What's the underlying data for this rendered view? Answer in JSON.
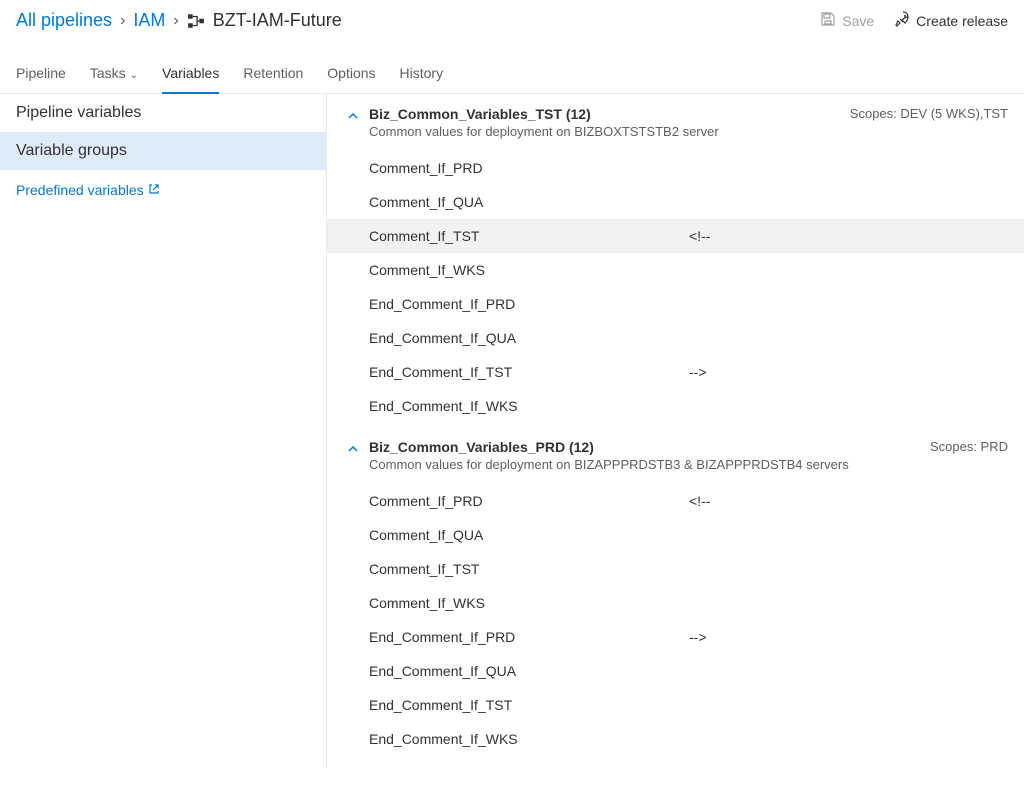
{
  "breadcrumb": {
    "root": "All pipelines",
    "parent": "IAM",
    "title": "BZT-IAM-Future"
  },
  "header_actions": {
    "save": "Save",
    "create_release": "Create release"
  },
  "tabs": {
    "pipeline": "Pipeline",
    "tasks": "Tasks",
    "variables": "Variables",
    "retention": "Retention",
    "options": "Options",
    "history": "History"
  },
  "sidebar": {
    "pipeline_vars": "Pipeline variables",
    "variable_groups": "Variable groups",
    "predefined": "Predefined variables"
  },
  "scopes_label": "Scopes:",
  "groups": [
    {
      "title": "Biz_Common_Variables_TST (12)",
      "desc": "Common values for deployment on BIZBOXTSTSTB2 server",
      "scopes": "DEV (5 WKS),TST",
      "vars": [
        {
          "name": "Comment_If_PRD",
          "value": ""
        },
        {
          "name": "Comment_If_QUA",
          "value": ""
        },
        {
          "name": "Comment_If_TST",
          "value": "<!--",
          "highlighted": true
        },
        {
          "name": "Comment_If_WKS",
          "value": ""
        },
        {
          "name": "End_Comment_If_PRD",
          "value": ""
        },
        {
          "name": "End_Comment_If_QUA",
          "value": ""
        },
        {
          "name": "End_Comment_If_TST",
          "value": "-->"
        },
        {
          "name": "End_Comment_If_WKS",
          "value": ""
        }
      ]
    },
    {
      "title": "Biz_Common_Variables_PRD (12)",
      "desc": "Common values for deployment on BIZAPPPRDSTB3 & BIZAPPPRDSTB4 servers",
      "scopes": "PRD",
      "vars": [
        {
          "name": "Comment_If_PRD",
          "value": "<!--"
        },
        {
          "name": "Comment_If_QUA",
          "value": ""
        },
        {
          "name": "Comment_If_TST",
          "value": ""
        },
        {
          "name": "Comment_If_WKS",
          "value": ""
        },
        {
          "name": "End_Comment_If_PRD",
          "value": "-->"
        },
        {
          "name": "End_Comment_If_QUA",
          "value": ""
        },
        {
          "name": "End_Comment_If_TST",
          "value": ""
        },
        {
          "name": "End_Comment_If_WKS",
          "value": ""
        }
      ]
    }
  ]
}
